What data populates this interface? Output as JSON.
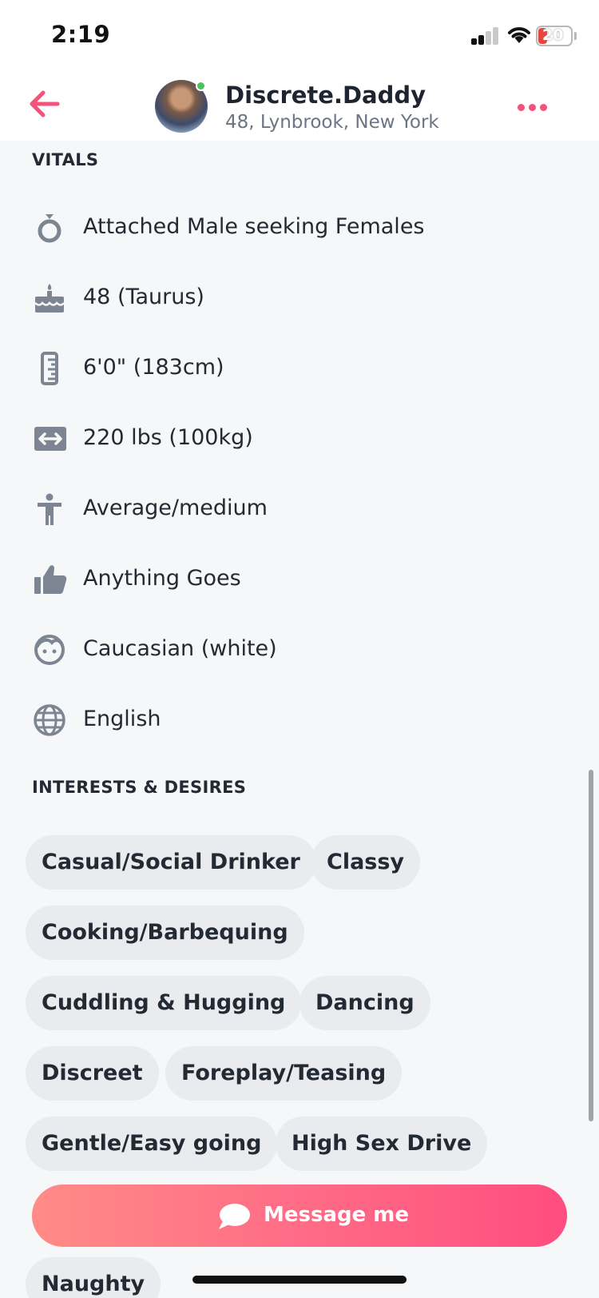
{
  "status_bar": {
    "time": "2:19",
    "battery_level": "20",
    "battery_color": "#e7463f"
  },
  "header": {
    "name": "Discrete.Daddy",
    "subtitle": "48, Lynbrook, New York",
    "online": true,
    "online_color": "#4cc05f",
    "accent": "#f4517c"
  },
  "vitals": {
    "title": "VITALS",
    "items": [
      {
        "icon": "ring-icon",
        "text": "Attached Male seeking Females"
      },
      {
        "icon": "birthday-cake-icon",
        "text": "48 (Taurus)"
      },
      {
        "icon": "ruler-icon",
        "text": "6'0\" (183cm)"
      },
      {
        "icon": "weight-arrows-icon",
        "text": "220 lbs (100kg)"
      },
      {
        "icon": "body-type-icon",
        "text": "Average/medium"
      },
      {
        "icon": "thumbs-up-icon",
        "text": "Anything Goes"
      },
      {
        "icon": "face-icon",
        "text": "Caucasian (white)"
      },
      {
        "icon": "globe-icon",
        "text": "English"
      }
    ]
  },
  "interests": {
    "title": "INTERESTS & DESIRES",
    "chips": [
      "Casual/Social Drinker",
      "Classy",
      "Cooking/Barbequing",
      "Cuddling & Hugging",
      "Dancing",
      "Discreet",
      "Foreplay/Teasing",
      "Gentle/Easy going",
      "High Sex Drive",
      "Naughty"
    ]
  },
  "actions": {
    "message_label": "Message me"
  }
}
